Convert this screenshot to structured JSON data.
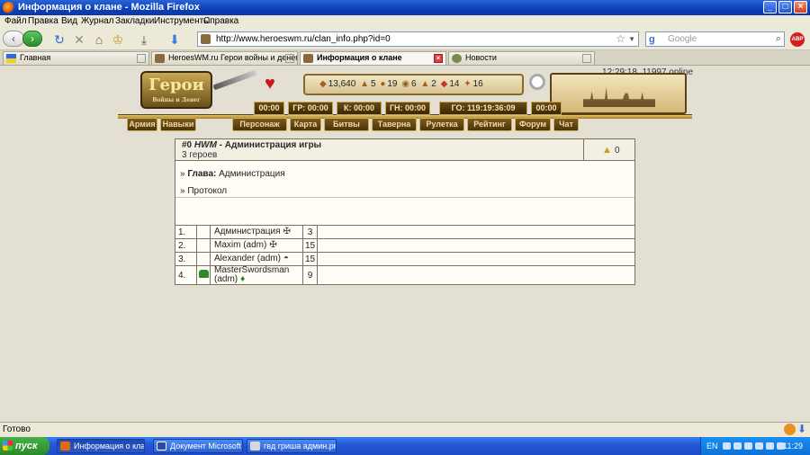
{
  "window": {
    "title": "Информация о клане - Mozilla Firefox",
    "controls": {
      "minimize": "_",
      "maximize": "□",
      "close": "×"
    }
  },
  "menubar": {
    "items": [
      "Файл",
      "Правка",
      "Вид",
      "Журнал",
      "Закладки",
      "Инструменты",
      "Справка"
    ]
  },
  "toolbar": {
    "url": "http://www.heroeswm.ru/clan_info.php?id=0",
    "search_placeholder": "Google",
    "search_engine_letter": "g"
  },
  "tabs": [
    {
      "label": "Главная",
      "icon": "ukraine-flag-icon"
    },
    {
      "label": "HeroesWM.ru Герои войны и денег. ...",
      "icon": "hwm-icon"
    },
    {
      "label": "Информация о клане",
      "icon": "hwm-icon",
      "active": true
    },
    {
      "label": "Новости",
      "icon": "news-icon"
    }
  ],
  "game": {
    "online_status": "12:29:18, 11997 online",
    "logo_text": "Герои",
    "logo_subtitle": "Войны и Денег",
    "resources": [
      {
        "icon": "gold-icon",
        "value": "13,640"
      },
      {
        "icon": "wood-icon",
        "value": "5"
      },
      {
        "icon": "ore-icon",
        "value": "19"
      },
      {
        "icon": "mercury-icon",
        "value": "6"
      },
      {
        "icon": "sulfur-icon",
        "value": "2"
      },
      {
        "icon": "crystal-icon",
        "value": "14"
      },
      {
        "icon": "gems-icon",
        "value": "16"
      }
    ],
    "timers": [
      "00:00",
      "ГР: 00:00",
      "К: 00:00",
      "ГН: 00:00",
      "ГО: 119:19:36:09",
      "00:00"
    ],
    "left_nav": [
      "Армия",
      "Навыки"
    ],
    "main_nav": [
      "Персонаж",
      "Карта",
      "Битвы",
      "Таверна",
      "Рулетка",
      "Рейтинг",
      "Форум",
      "Чат"
    ]
  },
  "clan": {
    "id_label": "#0",
    "tag": "HWM",
    "name_separator": " - ",
    "name": "Администрация игры",
    "heroes_count": "3 героев",
    "rating": "0",
    "leader_prefix": "» ",
    "leader_label": "Глава:",
    "leader_value": "Администрация",
    "protocol_link": "» Протокол"
  },
  "members": [
    {
      "num": "1.",
      "faction": "",
      "name": "Администрация",
      "rank_icon": "cross-icon",
      "level": "3"
    },
    {
      "num": "2.",
      "faction": "",
      "name": "Maxim (adm)",
      "rank_icon": "cross-icon",
      "level": "15"
    },
    {
      "num": "3.",
      "faction": "",
      "name": "Alexander (adm)",
      "rank_icon": "helmet-icon",
      "level": "15"
    },
    {
      "num": "4.",
      "faction": "elf-icon",
      "name": "MasterSwordsman (adm)",
      "rank_icon": "leaf-icon",
      "level": "9"
    }
  ],
  "statusbar": {
    "text": "Готово"
  },
  "taskbar": {
    "start_label": "пуск",
    "tasks": [
      {
        "label": "Информация о клан...",
        "active": true
      },
      {
        "label": "Документ Microsoft ...",
        "active": false
      },
      {
        "label": "гвд гриша админ.pn...",
        "active": false
      }
    ],
    "language": "EN",
    "clock": "11:29"
  }
}
